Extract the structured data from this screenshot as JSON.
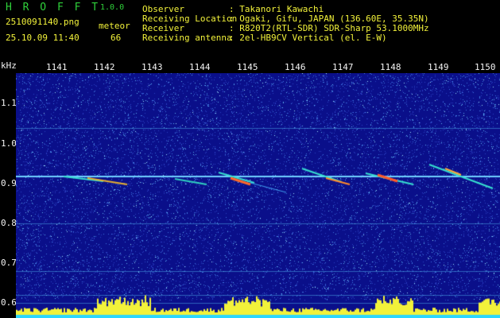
{
  "header": {
    "logo": "H R O F F T",
    "version": "1.0.0",
    "filename": "2510091140.png",
    "mode": "meteor",
    "datetime": "25.10.09 11:40",
    "count": "66",
    "info": [
      {
        "label": "Observer",
        "value": ": Takanori Kawachi"
      },
      {
        "label": "Receiving Location",
        "value": ": Ogaki, Gifu, JAPAN (136.60E, 35.35N)"
      },
      {
        "label": "Receiver",
        "value": ": R820T2(RTL-SDR) SDR-Sharp 53.1000MHz"
      },
      {
        "label": "Receiving antenna",
        "value": ": 2el-HB9CV Vertical (el. E-W)"
      }
    ]
  },
  "axes": {
    "y_unit": "kHz",
    "x_ticks": [
      "1141",
      "1142",
      "1143",
      "1144",
      "1145",
      "1146",
      "1147",
      "1148",
      "1149",
      "1150"
    ],
    "y_ticks": [
      "1.1",
      "1.0",
      "0.9",
      "0.8",
      "0.7",
      "0.6"
    ]
  },
  "colors": {
    "background": "#000000",
    "plot_bg": "#0a0f8a",
    "text_header": "#2fd13a",
    "text_info": "#f2f23a",
    "text_labels": "#f4f4f4",
    "signal_bar": "#f2f23a",
    "baseline": "#2ad7ff"
  }
}
